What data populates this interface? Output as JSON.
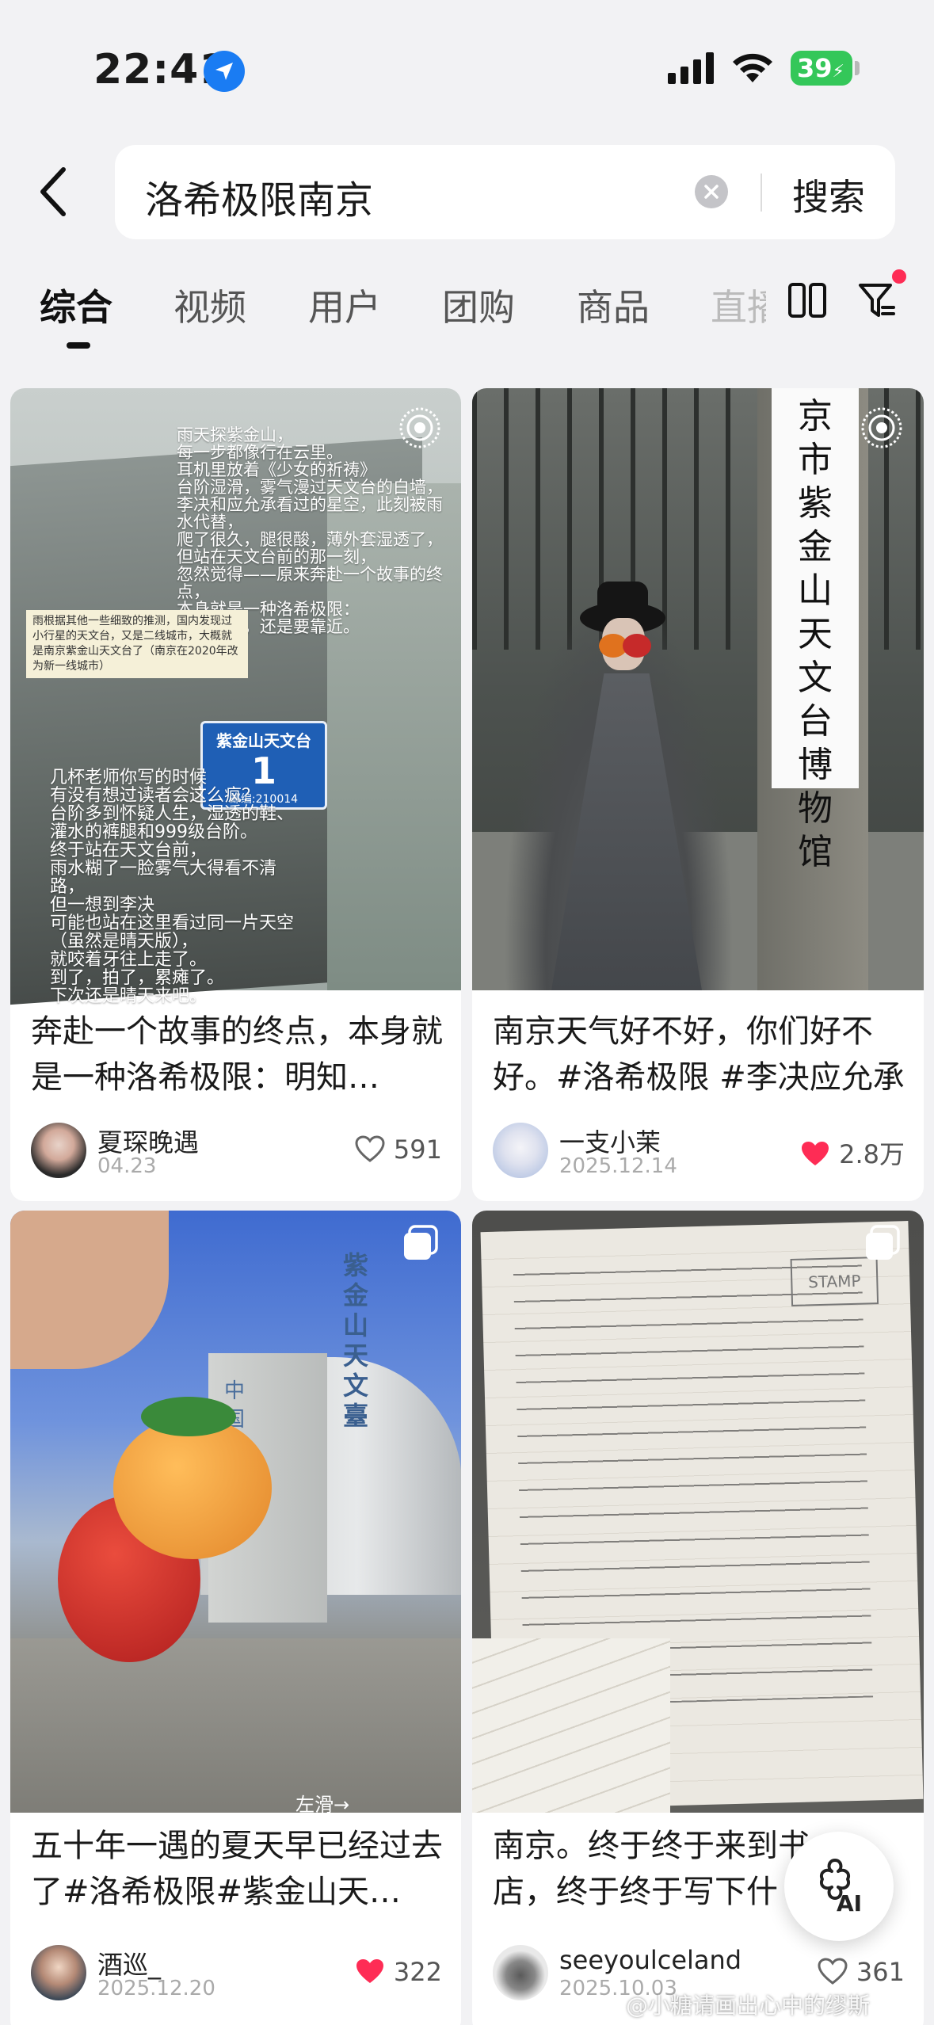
{
  "status_bar": {
    "time": "22:41",
    "battery": "39"
  },
  "search": {
    "query": "洛希极限南京",
    "button": "搜索"
  },
  "tabs": [
    {
      "label": "综合",
      "active": true
    },
    {
      "label": "视频"
    },
    {
      "label": "用户"
    },
    {
      "label": "团购"
    },
    {
      "label": "商品"
    },
    {
      "label": "直播"
    }
  ],
  "cards": [
    {
      "title": "奔赴一个故事的终点，本身就是一种洛希极限：明知…",
      "author": "夏琛晚遇",
      "date": "04.23",
      "likes": "591",
      "liked": false,
      "overlay_top": "雨天探紫金山，\n每一步都像行在云里。\n耳机里放着《少女的祈祷》\n台阶湿滑，雾气漫过天文台的白墙，\n李决和应允承看过的星空，此刻被雨水代替，\n爬了很久，腿很酸，薄外套湿透了，\n但站在天文台前的那一刻，\n忽然觉得——原来奔赴一个故事的终点，\n本身就是一种洛希极限：\n明知会碎，还是要靠近。",
      "overlay_note": "雨根据其他一些细致的推测，国内发现过小行星的天文台，又是二线城市，大概就是南京紫金山天文台了（南京在2020年改为新一线城市）",
      "sign_name": "紫金山天文台",
      "sign_num": "1",
      "sign_code": "邮编:210014",
      "overlay_bottom": "几杯老师你写的时候\n有没有想过读者会这么疯？\n台阶多到怀疑人生，湿透的鞋、\n灌水的裤腿和999级台阶。\n终于站在天文台前，\n雨水糊了一脸雾气大得看不清路，\n但一想到李决\n可能也站在这里看过同一片天空\n（虽然是晴天版），\n就咬着牙往上走了。\n到了，拍了，累瘫了。\n下次还是晴天来吧。"
    },
    {
      "title": "南京天气好不好，你们好不好。#洛希极限 #李决应允承",
      "author": "一支小茉",
      "date": "2025.12.14",
      "likes": "2.8万",
      "liked": true,
      "sign_text": "京市紫金山天文台博物馆"
    },
    {
      "title": "五十年一遇的夏天早已经过去了#洛希极限#紫金山天…",
      "author": "酒巡_",
      "date": "2025.12.20",
      "likes": "322",
      "liked": true,
      "building_text_1": "中国",
      "building_text_2": "紫金山天文臺",
      "swipe_hint": "左滑→"
    },
    {
      "title": "南京。终于终于来到书店，终于终于写下什",
      "author": "seeyoulceland",
      "date": "2025.10.03",
      "likes": "361",
      "liked": false,
      "stamp": "STAMP"
    }
  ],
  "ai_button": {
    "label": "AI"
  },
  "watermark": "@小糖请画出心中的缪斯",
  "colors": {
    "accent_red": "#fe2c55",
    "location_blue": "#1a7cf3",
    "battery_green": "#34c759"
  }
}
